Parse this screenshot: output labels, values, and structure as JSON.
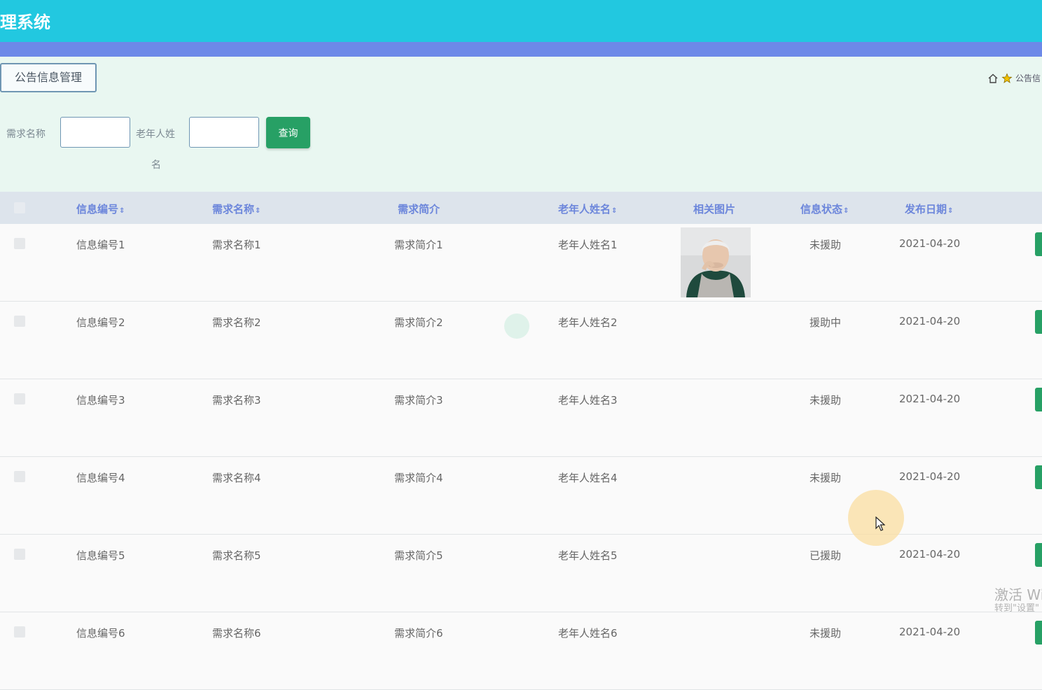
{
  "app": {
    "title": "理系统"
  },
  "section": {
    "title": "公告信息管理"
  },
  "breadcrumb": {
    "current": "公告信"
  },
  "filters": {
    "demand_name_label": "需求名称",
    "elder_name_label_line1": "老年人姓",
    "elder_name_label_line2": "名",
    "demand_name_value": "",
    "elder_name_value": "",
    "query_button": "查询"
  },
  "table": {
    "columns": [
      "信息编号",
      "需求名称",
      "需求简介",
      "老年人姓名",
      "相关图片",
      "信息状态",
      "发布日期"
    ],
    "sort_icon": "⇕",
    "rows": [
      {
        "id": "信息编号1",
        "name": "需求名称1",
        "intro": "需求简介1",
        "elder": "老年人姓名1",
        "has_image": true,
        "status": "未援助",
        "date": "2021-04-20"
      },
      {
        "id": "信息编号2",
        "name": "需求名称2",
        "intro": "需求简介2",
        "elder": "老年人姓名2",
        "has_image": false,
        "status": "援助中",
        "date": "2021-04-20"
      },
      {
        "id": "信息编号3",
        "name": "需求名称3",
        "intro": "需求简介3",
        "elder": "老年人姓名3",
        "has_image": false,
        "status": "未援助",
        "date": "2021-04-20"
      },
      {
        "id": "信息编号4",
        "name": "需求名称4",
        "intro": "需求简介4",
        "elder": "老年人姓名4",
        "has_image": false,
        "status": "未援助",
        "date": "2021-04-20"
      },
      {
        "id": "信息编号5",
        "name": "需求名称5",
        "intro": "需求简介5",
        "elder": "老年人姓名5",
        "has_image": false,
        "status": "已援助",
        "date": "2021-04-20"
      },
      {
        "id": "信息编号6",
        "name": "需求名称6",
        "intro": "需求简介6",
        "elder": "老年人姓名6",
        "has_image": false,
        "status": "未援助",
        "date": "2021-04-20"
      }
    ]
  },
  "watermark": {
    "line1": "激活 Wi",
    "line2": "转到\"设置\""
  },
  "colors": {
    "header": "#22c8e0",
    "subheader": "#6d89e8",
    "panel": "#e9f7f1",
    "accent_button": "#27a065",
    "column_header_text": "#6c86db"
  }
}
